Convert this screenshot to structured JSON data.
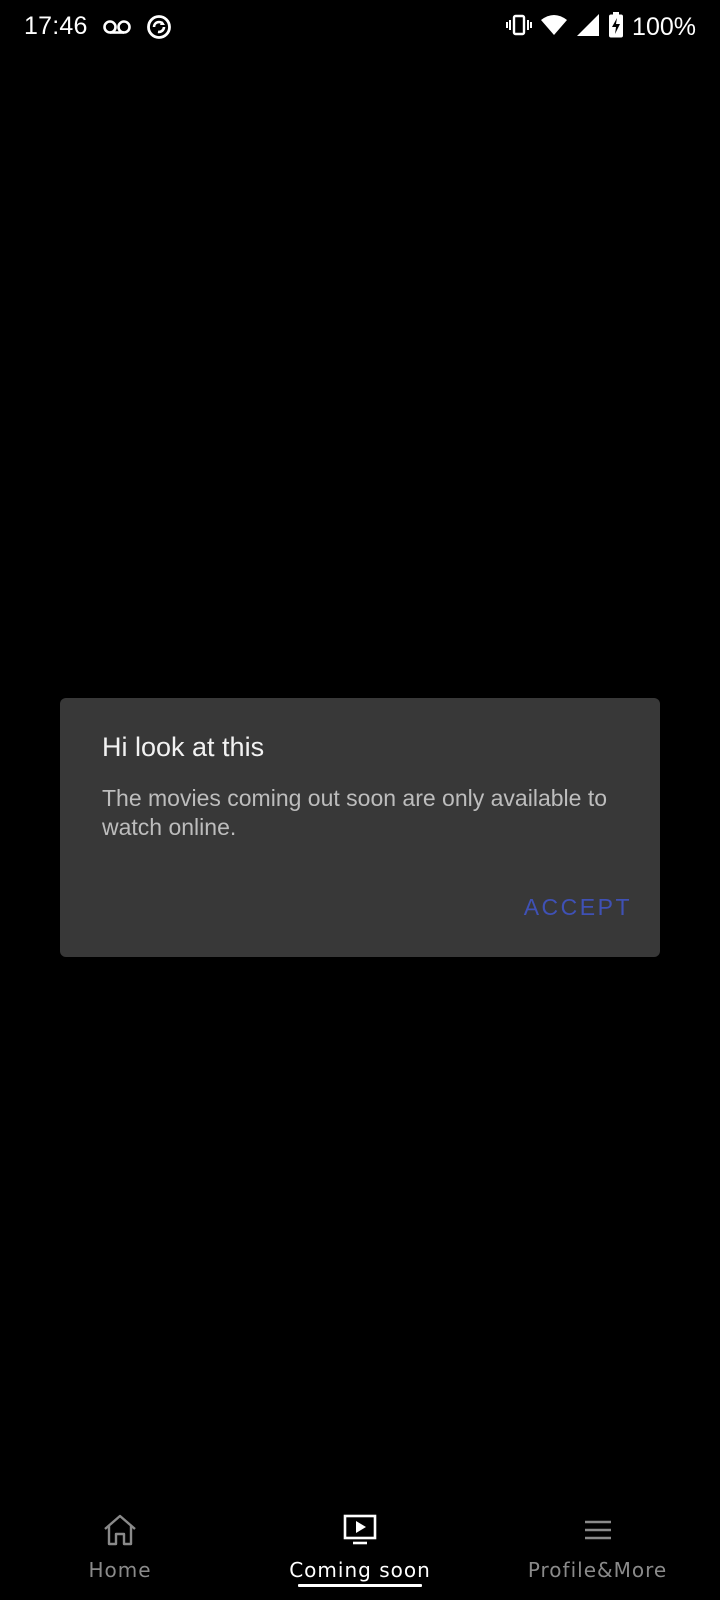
{
  "status_bar": {
    "time": "17:46",
    "battery_text": "100%",
    "icons": [
      "voicemail-icon",
      "sync-icon",
      "vibrate-icon",
      "wifi-icon",
      "cell-signal-icon",
      "battery-charging-icon"
    ]
  },
  "dialog": {
    "title": "Hi look at this",
    "message": "The movies coming out soon are only available to watch online.",
    "accept_label": "ACCEPT",
    "accept_color": "#3f51b5"
  },
  "bottom_nav": {
    "items": [
      {
        "label": "Home",
        "icon": "home-icon",
        "active": false
      },
      {
        "label": "Coming soon",
        "icon": "play-tv-icon",
        "active": true
      },
      {
        "label": "Profile&More",
        "icon": "menu-icon",
        "active": false
      }
    ]
  },
  "colors": {
    "background": "#000000",
    "dialog_bg": "#383838",
    "inactive_nav": "#8a8a8a"
  }
}
